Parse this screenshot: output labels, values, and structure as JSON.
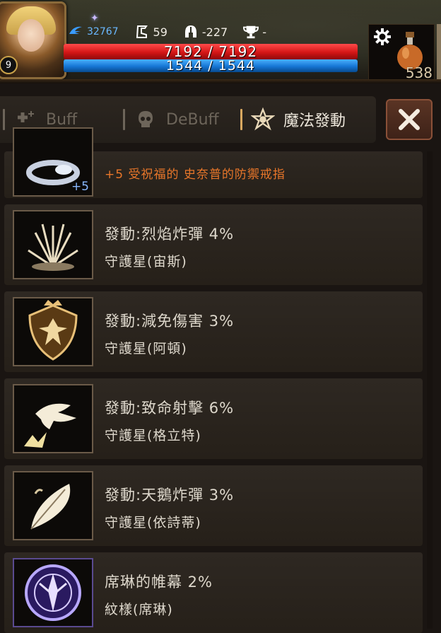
{
  "hud": {
    "level": "9",
    "stats": {
      "speed": "32767",
      "move": "59",
      "armor": "-227",
      "trophy": "-"
    },
    "hp": {
      "text": "7192 / 7192",
      "fraction": 1.0
    },
    "mp": {
      "text": "1544 / 1544",
      "fraction": 1.0
    },
    "potion_count": "538"
  },
  "tabs": [
    {
      "label": "Buff",
      "active": false
    },
    {
      "label": "DeBuff",
      "active": false
    },
    {
      "label": "魔法發動",
      "active": true
    }
  ],
  "close_icon": "close-icon",
  "items": [
    {
      "enhance_text": "+5 受祝福的 史奈普的防禦戒指",
      "thumb_badge": "+5"
    },
    {
      "title": "發動:烈焰炸彈 4%",
      "source": "守護星(宙斯)"
    },
    {
      "title": "發動:減免傷害 3%",
      "source": "守護星(阿頓)"
    },
    {
      "title": "發動:致命射擊 6%",
      "source": "守護星(格立特)"
    },
    {
      "title": "發動:天鵝炸彈 3%",
      "source": "守護星(依詩蒂)"
    },
    {
      "title": "席琳的帷幕 2%",
      "source": "紋樣(席琳)"
    }
  ],
  "colors": {
    "hp": "#d41616",
    "mp": "#1676d4",
    "enhance_text": "#e8762a",
    "active_tab_marker": "#d8a860"
  }
}
